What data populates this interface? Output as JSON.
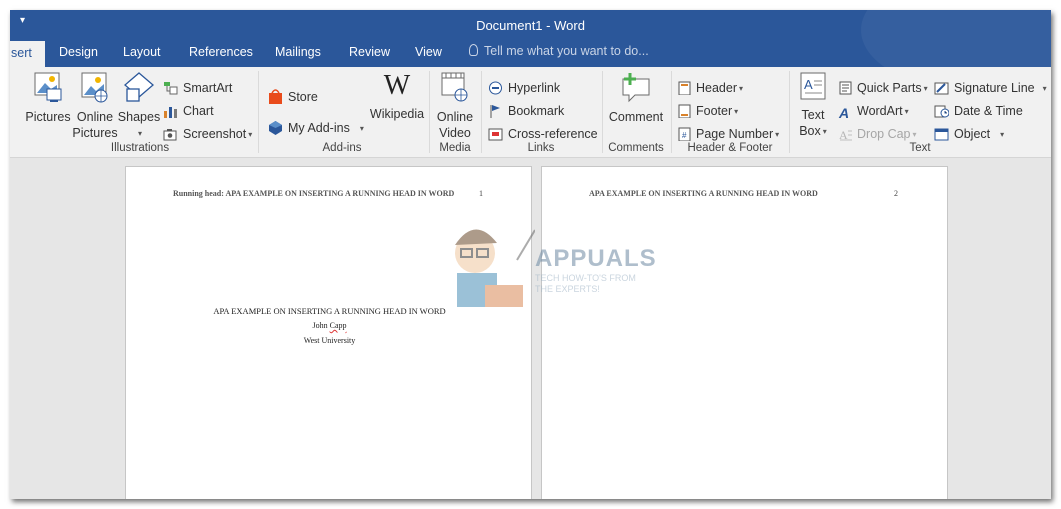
{
  "window": {
    "title": "Document1 - Word",
    "qat_glyph": "▾"
  },
  "tabs": {
    "active": "sert",
    "items": [
      "Design",
      "Layout",
      "References",
      "Mailings",
      "Review",
      "View"
    ],
    "tell_me": "Tell me what you want to do..."
  },
  "ribbon": {
    "illustrations": {
      "label": "Illustrations",
      "pictures": "Pictures",
      "online_pictures_1": "Online",
      "online_pictures_2": "Pictures",
      "shapes": "Shapes",
      "smartart": "SmartArt",
      "chart": "Chart",
      "screenshot": "Screenshot"
    },
    "addins": {
      "label": "Add-ins",
      "store": "Store",
      "my_addins": "My Add-ins",
      "wikipedia": "Wikipedia",
      "wikipedia_glyph": "W"
    },
    "media": {
      "label": "Media",
      "online_video_1": "Online",
      "online_video_2": "Video"
    },
    "links": {
      "label": "Links",
      "hyperlink": "Hyperlink",
      "bookmark": "Bookmark",
      "cross_reference": "Cross-reference"
    },
    "comments": {
      "label": "Comments",
      "comment": "Comment"
    },
    "header_footer": {
      "label": "Header & Footer",
      "header": "Header",
      "footer": "Footer",
      "page_number": "Page Number"
    },
    "text": {
      "label": "Text",
      "text_box_1": "Text",
      "text_box_2": "Box",
      "quick_parts": "Quick Parts",
      "wordart": "WordArt",
      "drop_cap": "Drop Cap",
      "signature_line": "Signature Line",
      "date_time": "Date & Time",
      "object": "Object"
    }
  },
  "pages": [
    {
      "header": "Running head: APA EXAMPLE ON INSERTING A RUNNING HEAD IN WORD",
      "number": "1",
      "title": "APA EXAMPLE ON INSERTING A RUNNING HEAD IN WORD",
      "author_first": "John",
      "author_last": "Capp",
      "institution": "West University"
    },
    {
      "header": "APA EXAMPLE ON INSERTING A RUNNING HEAD IN WORD",
      "number": "2"
    }
  ],
  "watermark": {
    "name": "APPUALS",
    "tagline_1": "TECH HOW-TO'S FROM",
    "tagline_2": "THE EXPERTS!"
  },
  "colors": {
    "brand": "#2b579a",
    "ribbon": "#f1f1f1",
    "workspace": "#e6e6e6"
  }
}
